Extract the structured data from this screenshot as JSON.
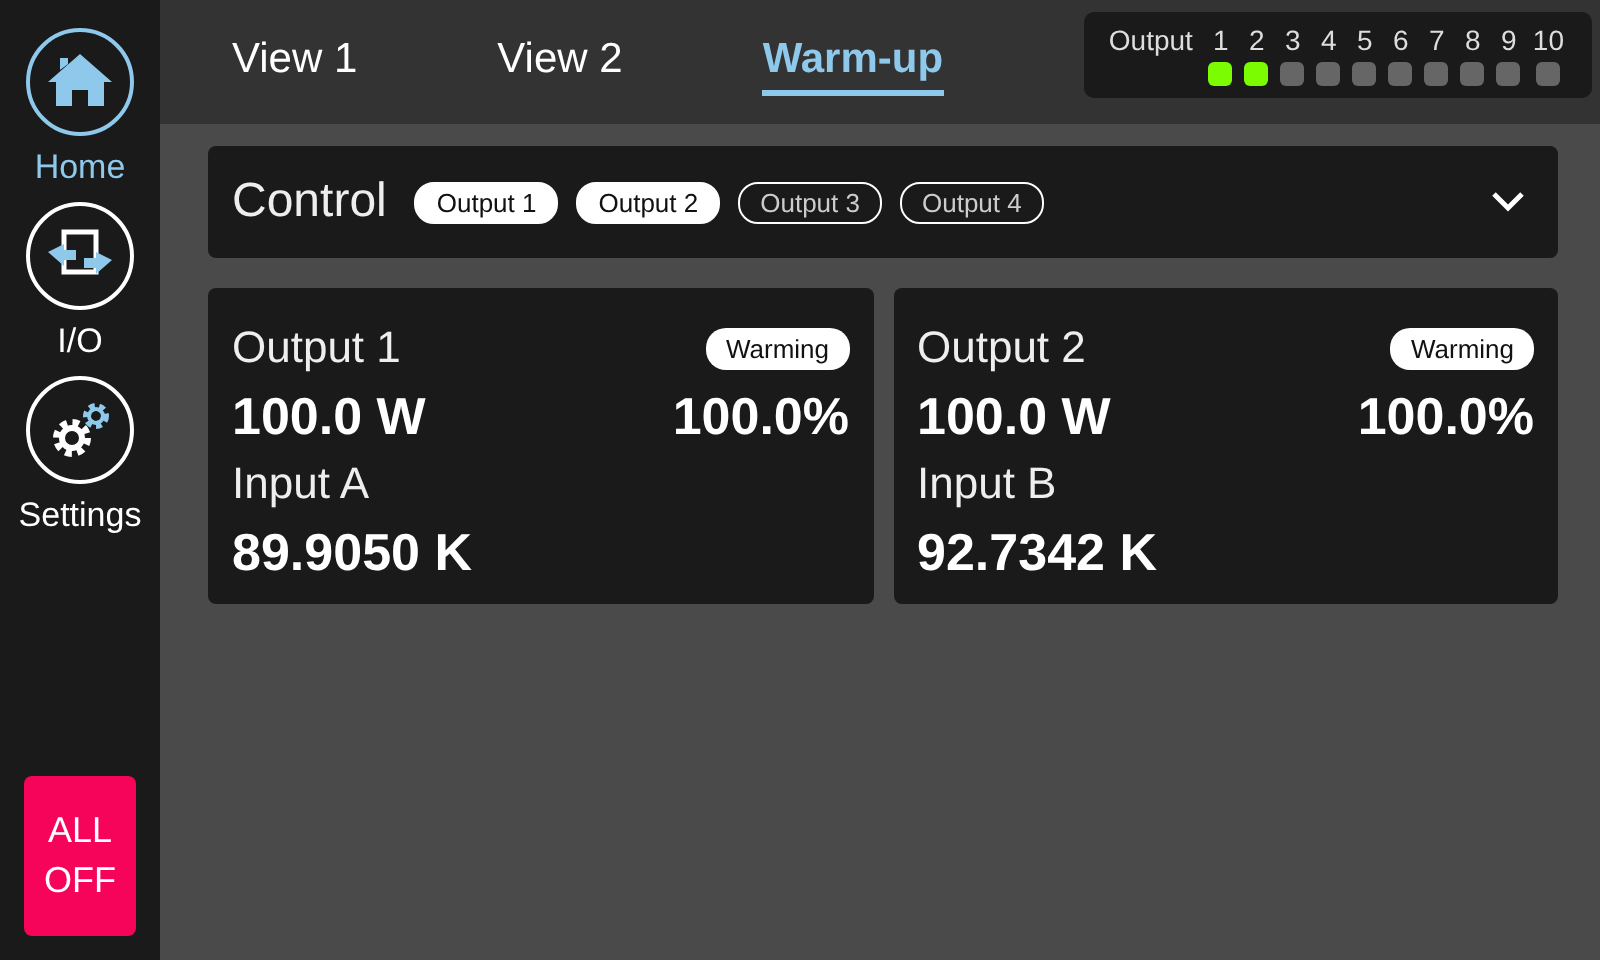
{
  "sidebar": {
    "items": [
      {
        "label": "Home",
        "kind": "home",
        "selected": true
      },
      {
        "label": "I/O",
        "kind": "io",
        "selected": false
      },
      {
        "label": "Settings",
        "kind": "gears",
        "selected": false
      }
    ],
    "all_off_button": "ALL OFF"
  },
  "tabs": [
    {
      "label": "View 1",
      "selected": false
    },
    {
      "label": "View 2",
      "selected": false
    },
    {
      "label": "Warm-up",
      "selected": true
    }
  ],
  "output_status": {
    "label": "Output",
    "outputs": [
      {
        "number": "1",
        "on": true
      },
      {
        "number": "2",
        "on": true
      },
      {
        "number": "3",
        "on": false
      },
      {
        "number": "4",
        "on": false
      },
      {
        "number": "5",
        "on": false
      },
      {
        "number": "6",
        "on": false
      },
      {
        "number": "7",
        "on": false
      },
      {
        "number": "8",
        "on": false
      },
      {
        "number": "9",
        "on": false
      },
      {
        "number": "10",
        "on": false
      }
    ]
  },
  "control": {
    "title": "Control",
    "expanded": false,
    "chips": [
      {
        "label": "Output 1",
        "selected": true
      },
      {
        "label": "Output 2",
        "selected": true
      },
      {
        "label": "Output 3",
        "selected": false
      },
      {
        "label": "Output 4",
        "selected": false
      }
    ]
  },
  "cards": [
    {
      "title": "Output 1",
      "badge": "Warming",
      "power": "100.0 W",
      "percent": "100.0%",
      "input_label": "Input A",
      "input_value": "89.9050 K"
    },
    {
      "title": "Output 2",
      "badge": "Warming",
      "power": "100.0 W",
      "percent": "100.0%",
      "input_label": "Input B",
      "input_value": "92.7342 K"
    }
  ]
}
